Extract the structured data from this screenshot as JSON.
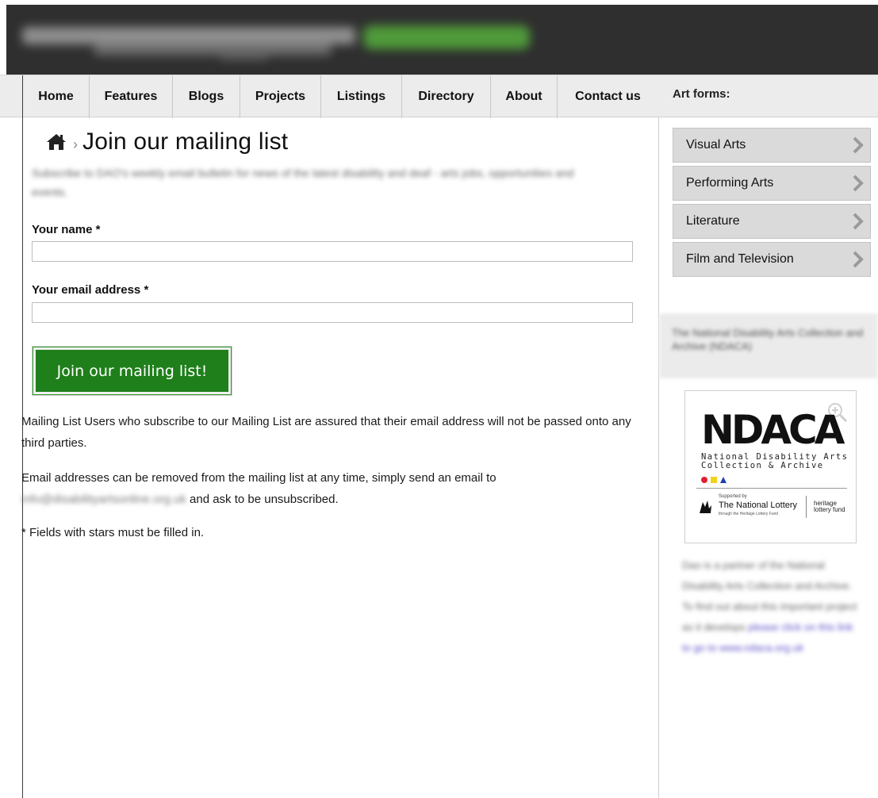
{
  "banner": {
    "logo_text": ""
  },
  "nav": {
    "items": [
      {
        "label": "Home",
        "width": 0
      },
      {
        "label": "Features"
      },
      {
        "label": "Blogs"
      },
      {
        "label": "Projects"
      },
      {
        "label": "Listings"
      },
      {
        "label": "Directory"
      },
      {
        "label": "About"
      },
      {
        "label": "Contact us"
      }
    ]
  },
  "sidebar": {
    "art_forms_heading": "Art forms:",
    "art_forms": [
      {
        "label": "Visual Arts"
      },
      {
        "label": "Performing Arts"
      },
      {
        "label": "Literature"
      },
      {
        "label": "Film and Television"
      }
    ],
    "ndaca_heading": "The National Disability Arts Collection and Archive (NDACA)",
    "ndaca_logo": {
      "main": "NDACA",
      "sub_line1": "National Disability Arts",
      "sub_line2": "Collection & Archive",
      "supported_by": "Supported by",
      "lottery_name": "The National Lottery",
      "lottery_tiny": "through the Heritage Lottery Fund",
      "heritage": "heritage lottery fund"
    },
    "partner_text": "Dao is a partner of the National Disability Arts Collection and Archive. To find out about this important project as it develops",
    "partner_link": "please click on this link to go to www.ndaca.org.uk"
  },
  "main": {
    "title": "Join our mailing list",
    "intro": "Subscribe to DAO's weekly email bulletin for news of the latest disability and deaf - arts jobs, opportunities and events.",
    "name_label": "Your name *",
    "name_value": "",
    "email_label": "Your email address *",
    "email_value": "",
    "submit_label": "Join our mailing list!",
    "privacy_text": "Mailing List Users who subscribe to our Mailing List are assured that their email address will not be passed onto any third parties.",
    "remove_text": "Email addresses can be removed from the mailing list at any time, simply send an email to",
    "remove_email": "info@disabilityartsonline.org.uk",
    "remove_suffix": " and ask to be unsubscribed.",
    "required_note": "* Fields with stars must be filled in."
  },
  "colors": {
    "submit_button": "#1f7f1b",
    "nav_background": "#ececec",
    "banner_background": "#2f2f2f"
  }
}
